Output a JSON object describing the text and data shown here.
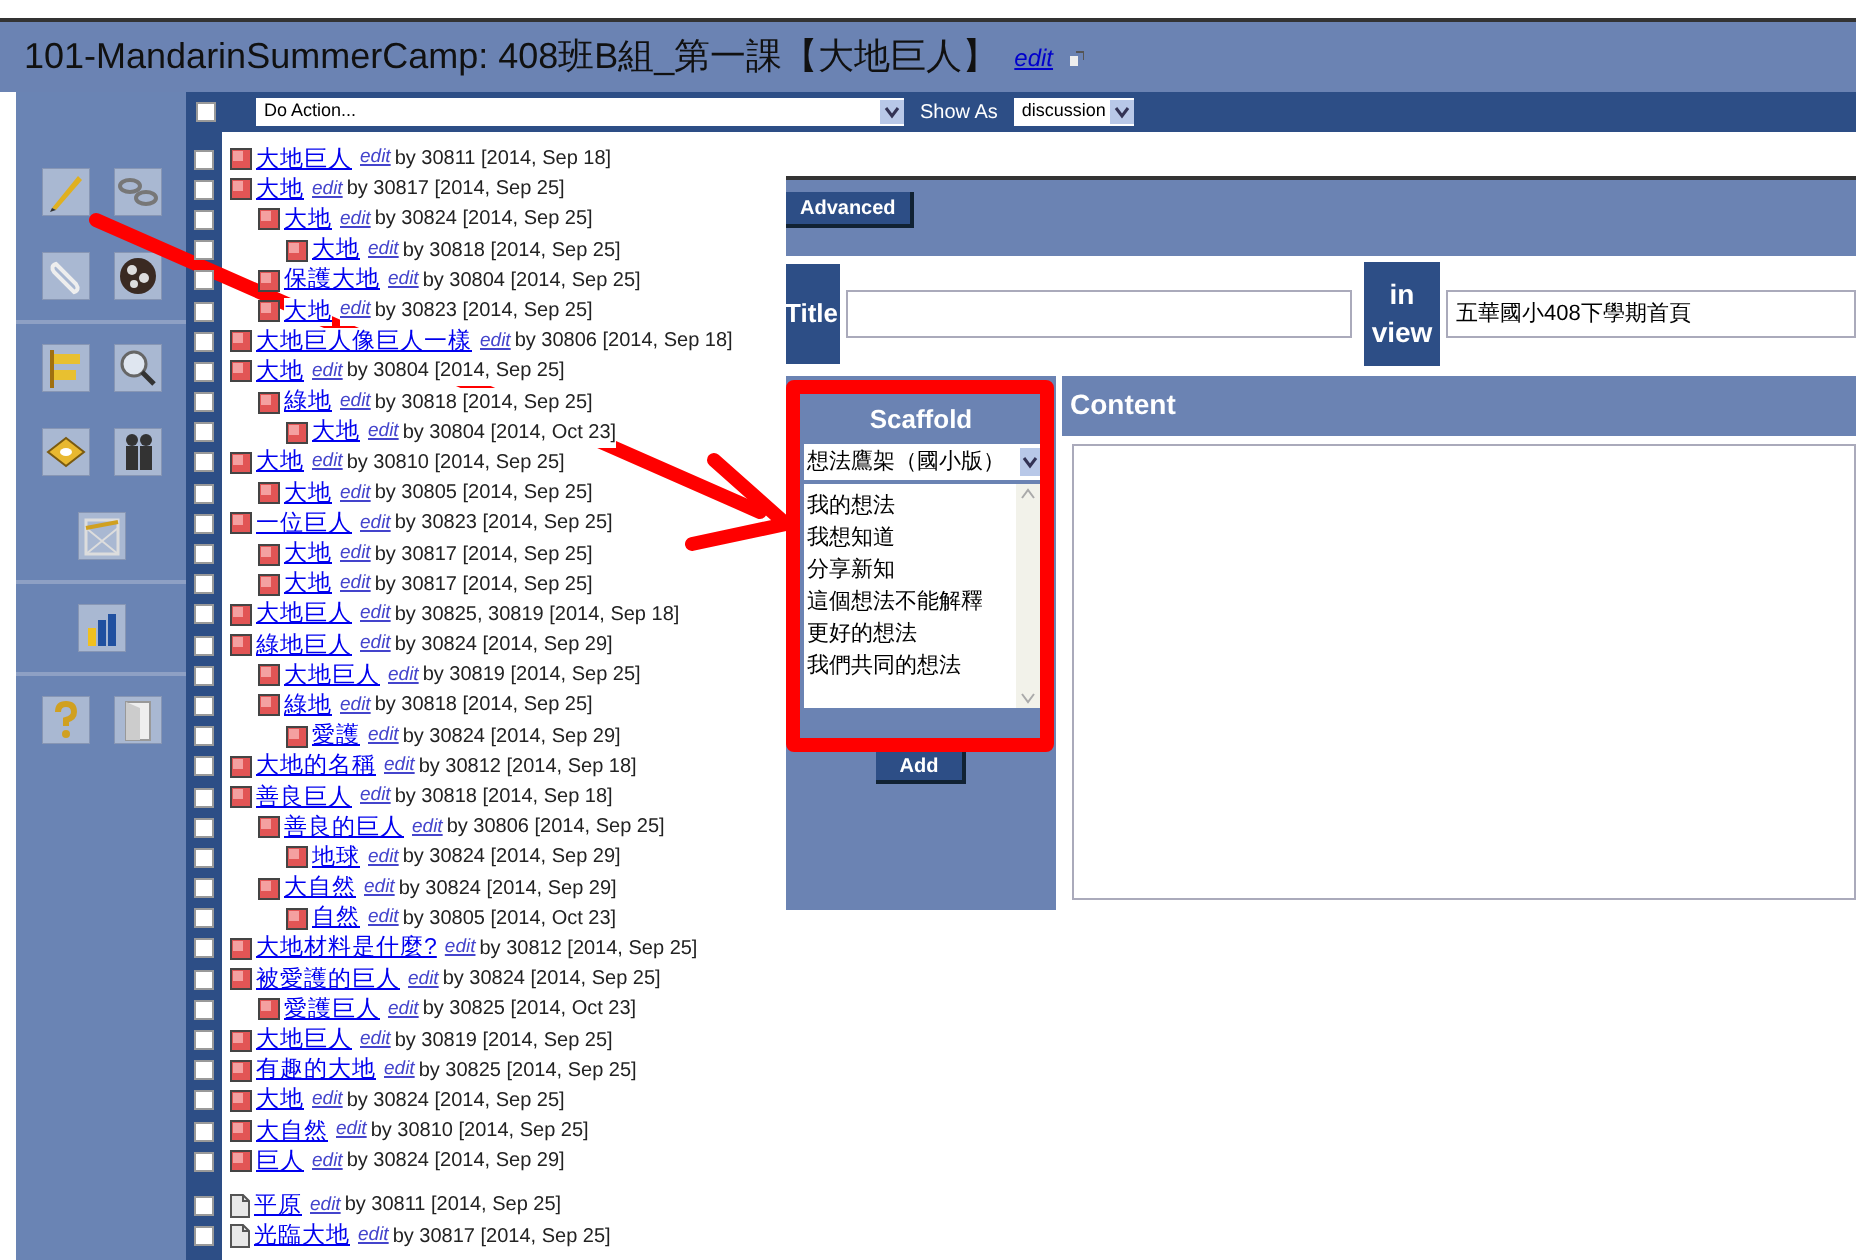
{
  "window": {
    "title": "101-MandarinSummerCamp: 408班B組_第一課【大地巨人】",
    "edit_link": "edit"
  },
  "toolbar": {
    "select_all_checked": false,
    "action": "Do Action...",
    "show_as_label": "Show As",
    "show_as": "discussion"
  },
  "notes": [
    {
      "kind": "note",
      "title": "大地巨人",
      "edit": "edit",
      "byline": "by 30811 [2014, Sep 18]",
      "checked": false
    },
    {
      "kind": "note",
      "title": "大地",
      "edit": "edit",
      "byline": "by 30817 [2014, Sep 25]",
      "checked": false,
      "children": [
        {
          "kind": "note",
          "title": "大地",
          "edit": "edit",
          "byline": "by 30824 [2014, Sep 25]",
          "checked": false,
          "children": [
            {
              "kind": "note",
              "title": "大地",
              "edit": "edit",
              "byline": "by 30818 [2014, Sep 25]",
              "checked": false
            }
          ]
        },
        {
          "kind": "note",
          "title": "保護大地",
          "edit": "edit",
          "byline": "by 30804 [2014, Sep 25]",
          "checked": false
        },
        {
          "kind": "note",
          "title": "大地",
          "edit": "edit",
          "byline": "by 30823 [2014, Sep 25]",
          "checked": false
        }
      ]
    },
    {
      "kind": "note",
      "title": "大地巨人像巨人一樣",
      "edit": "edit",
      "byline": "by 30806 [2014, Sep 18]",
      "checked": false
    },
    {
      "kind": "note",
      "title": "大地",
      "edit": "edit",
      "byline": "by 30804 [2014, Sep 25]",
      "checked": false,
      "children": [
        {
          "kind": "note",
          "title": "綠地",
          "edit": "edit",
          "byline": "by 30818 [2014, Sep 25]",
          "checked": false,
          "children": [
            {
              "kind": "note",
              "title": "大地",
              "edit": "edit",
              "byline": "by 30804 [2014, Oct 23]",
              "checked": false
            }
          ]
        }
      ]
    },
    {
      "kind": "note",
      "title": "大地",
      "edit": "edit",
      "byline": "by 30810 [2014, Sep 25]",
      "checked": false,
      "children": [
        {
          "kind": "note",
          "title": "大地",
          "edit": "edit",
          "byline": "by 30805 [2014, Sep 25]",
          "checked": false
        }
      ]
    },
    {
      "kind": "note",
      "title": "一位巨人",
      "edit": "edit",
      "byline": "by 30823 [2014, Sep 25]",
      "checked": false,
      "children": [
        {
          "kind": "note",
          "title": "大地",
          "edit": "edit",
          "byline": "by 30817 [2014, Sep 25]",
          "checked": false
        },
        {
          "kind": "note",
          "title": "大地",
          "edit": "edit",
          "byline": "by 30817 [2014, Sep 25]",
          "checked": false
        }
      ]
    },
    {
      "kind": "note",
      "title": "大地巨人",
      "edit": "edit",
      "byline": "by 30825, 30819 [2014, Sep 18]",
      "checked": false
    },
    {
      "kind": "note",
      "title": "綠地巨人",
      "edit": "edit",
      "byline": "by 30824 [2014, Sep 29]",
      "checked": false,
      "children": [
        {
          "kind": "note",
          "title": "大地巨人",
          "edit": "edit",
          "byline": "by 30819 [2014, Sep 25]",
          "checked": false
        },
        {
          "kind": "note",
          "title": "綠地",
          "edit": "edit",
          "byline": "by 30818 [2014, Sep 25]",
          "checked": false,
          "children": [
            {
              "kind": "note",
              "title": "愛護",
              "edit": "edit",
              "byline": "by 30824 [2014, Sep 29]",
              "checked": false
            }
          ]
        }
      ]
    },
    {
      "kind": "note",
      "title": "大地的名稱",
      "edit": "edit",
      "byline": "by 30812 [2014, Sep 18]",
      "checked": false
    },
    {
      "kind": "note",
      "title": "善良巨人",
      "edit": "edit",
      "byline": "by 30818 [2014, Sep 18]",
      "checked": false,
      "children": [
        {
          "kind": "note",
          "title": "善良的巨人",
          "edit": "edit",
          "byline": "by 30806 [2014, Sep 25]",
          "checked": false,
          "children": [
            {
              "kind": "note",
              "title": "地球",
              "edit": "edit",
              "byline": "by 30824 [2014, Sep 29]",
              "checked": false
            }
          ]
        },
        {
          "kind": "note",
          "title": "大自然",
          "edit": "edit",
          "byline": "by 30824 [2014, Sep 29]",
          "checked": false,
          "children": [
            {
              "kind": "note",
              "title": "自然",
              "edit": "edit",
              "byline": "by 30805 [2014, Oct 23]",
              "checked": false
            }
          ]
        }
      ]
    },
    {
      "kind": "note",
      "title": "大地材料是什麼?",
      "edit": "edit",
      "byline": "by 30812 [2014, Sep 25]",
      "checked": false
    },
    {
      "kind": "note",
      "title": "被愛護的巨人",
      "edit": "edit",
      "byline": "by 30824 [2014, Sep 25]",
      "checked": false,
      "children": [
        {
          "kind": "note",
          "title": "愛護巨人",
          "edit": "edit",
          "byline": "by 30825 [2014, Oct 23]",
          "checked": false
        }
      ]
    },
    {
      "kind": "note",
      "title": "大地巨人",
      "edit": "edit",
      "byline": "by 30819 [2014, Sep 25]",
      "checked": false
    },
    {
      "kind": "note",
      "title": "有趣的大地",
      "edit": "edit",
      "byline": "by 30825 [2014, Sep 25]",
      "checked": false
    },
    {
      "kind": "note",
      "title": "大地",
      "edit": "edit",
      "byline": "by 30824 [2014, Sep 25]",
      "checked": false
    },
    {
      "kind": "note",
      "title": "大自然",
      "edit": "edit",
      "byline": "by 30810 [2014, Sep 25]",
      "checked": false
    },
    {
      "kind": "note",
      "title": "巨人",
      "edit": "edit",
      "byline": "by 30824 [2014, Sep 29]",
      "checked": false
    }
  ],
  "pages": [
    {
      "kind": "page",
      "title": "平原",
      "edit": "edit",
      "byline": "by 30811 [2014, Sep 25]",
      "checked": false
    },
    {
      "kind": "page",
      "title": "光臨大地",
      "edit": "edit",
      "byline": "by 30817 [2014, Sep 25]",
      "checked": false
    }
  ],
  "editor": {
    "advanced_button": "Advanced",
    "title_label": "Title",
    "in_view_label": "in view",
    "view_value": "五華國小408下學期首頁",
    "scaffold": {
      "header": "Scaffold",
      "selected": "想法鷹架（國小版）",
      "supports": [
        "我的想法",
        "我想知道",
        "分享新知",
        "這個想法不能解釋",
        "更好的想法",
        "我們共同的想法"
      ],
      "add_button": "Add"
    },
    "content_header": "Content"
  }
}
